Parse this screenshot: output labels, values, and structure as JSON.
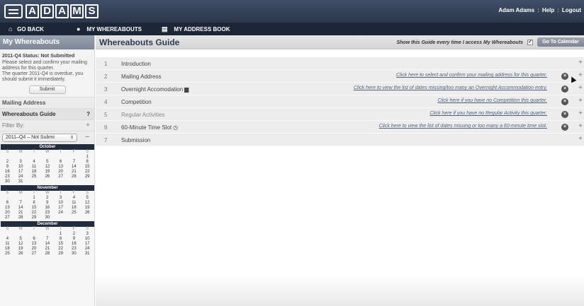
{
  "app": {
    "logo_letters": [
      "A",
      "D",
      "A",
      "M",
      "S"
    ],
    "user": "Adam Adams",
    "help": "Help",
    "logout": "Logout",
    "sep": ":"
  },
  "nav": {
    "go_back": "GO BACK",
    "my_whereabouts": "MY WHEREABOUTS",
    "my_address_book": "MY ADDRESS BOOK"
  },
  "sidebar": {
    "header": "My Whereabouts",
    "status_title": "2011-Q4 Status: Not Submitted",
    "status_line1": "Please select and confirm your mailing address for this quarter.",
    "status_line2": "The quarter 2011-Q4 is overdue, you should submit it immediately.",
    "submit": "Submit",
    "mailing_address": "Mailing Address",
    "guide": "Whereabouts Guide",
    "guide_help": "?",
    "filter_by": "Filter By:",
    "plus": "+",
    "minus": "–",
    "filter_value": "2011–Q4 – Not Submi",
    "filter_arrows": "⇕"
  },
  "calendars": [
    {
      "month": "October",
      "dow": [
        "S",
        "M",
        "T",
        "W",
        "T",
        "F",
        "S"
      ],
      "weeks": [
        [
          "",
          "",
          "",
          "",
          "",
          "",
          "1"
        ],
        [
          "2",
          "3",
          "4",
          "5",
          "6",
          "7",
          "8"
        ],
        [
          "9",
          "10",
          "11",
          "12",
          "13",
          "14",
          "15"
        ],
        [
          "16",
          "17",
          "18",
          "19",
          "20",
          "21",
          "22"
        ],
        [
          "23",
          "24",
          "25",
          "26",
          "27",
          "28",
          "29"
        ],
        [
          "30",
          "31",
          "",
          "",
          "",
          "",
          ""
        ]
      ]
    },
    {
      "month": "November",
      "dow": [
        "S",
        "M",
        "T",
        "W",
        "T",
        "F",
        "S"
      ],
      "weeks": [
        [
          "",
          "",
          "1",
          "2",
          "3",
          "4",
          "5"
        ],
        [
          "6",
          "7",
          "8",
          "9",
          "10",
          "11",
          "12"
        ],
        [
          "13",
          "14",
          "15",
          "16",
          "17",
          "18",
          "19"
        ],
        [
          "20",
          "21",
          "22",
          "23",
          "24",
          "25",
          "26"
        ],
        [
          "27",
          "28",
          "29",
          "30",
          "",
          "",
          ""
        ]
      ]
    },
    {
      "month": "December",
      "dow": [
        "S",
        "M",
        "T",
        "W",
        "T",
        "F",
        "S"
      ],
      "weeks": [
        [
          "",
          "",
          "",
          "",
          "1",
          "2",
          "3"
        ],
        [
          "4",
          "5",
          "6",
          "7",
          "8",
          "9",
          "10"
        ],
        [
          "11",
          "12",
          "13",
          "14",
          "15",
          "16",
          "17"
        ],
        [
          "18",
          "19",
          "20",
          "21",
          "22",
          "23",
          "24"
        ],
        [
          "25",
          "26",
          "27",
          "28",
          "29",
          "30",
          "31"
        ]
      ]
    }
  ],
  "main": {
    "title": "Whereabouts Guide",
    "show_guide": "Show this Guide every time I access My Whereabouts",
    "show_guide_checked": "✓",
    "calendar_button": "Go To Calendar",
    "steps": [
      {
        "num": "1",
        "label": "Introduction",
        "link": "",
        "icon": "",
        "x": false,
        "muted": false
      },
      {
        "num": "2",
        "label": "Mailing Address",
        "link": "Click here to select and confirm your mailing address for this quarter.",
        "icon": "",
        "x": true,
        "muted": false
      },
      {
        "num": "3",
        "label": "Overnight Accomodation",
        "link": "Click here to view the list of dates missing/too many an Overnight Accommodation entry.",
        "icon": "bed-icon",
        "x": true,
        "muted": false
      },
      {
        "num": "4",
        "label": "Competition",
        "link": "Click here if you have no Competition this quarter.",
        "icon": "",
        "x": true,
        "muted": false
      },
      {
        "num": "5",
        "label": "Regular Activities",
        "link": "Click here if you have no Regular Activity this quarter.",
        "icon": "",
        "x": true,
        "muted": true
      },
      {
        "num": "6",
        "label": "60-Minute Time Slot",
        "link": "Click here to view the list of dates missing or too many a 60-minute time slot.",
        "icon": "clock-icon",
        "x": true,
        "muted": false
      },
      {
        "num": "7",
        "label": "Submission",
        "link": "",
        "icon": "",
        "x": false,
        "muted": false
      }
    ]
  }
}
